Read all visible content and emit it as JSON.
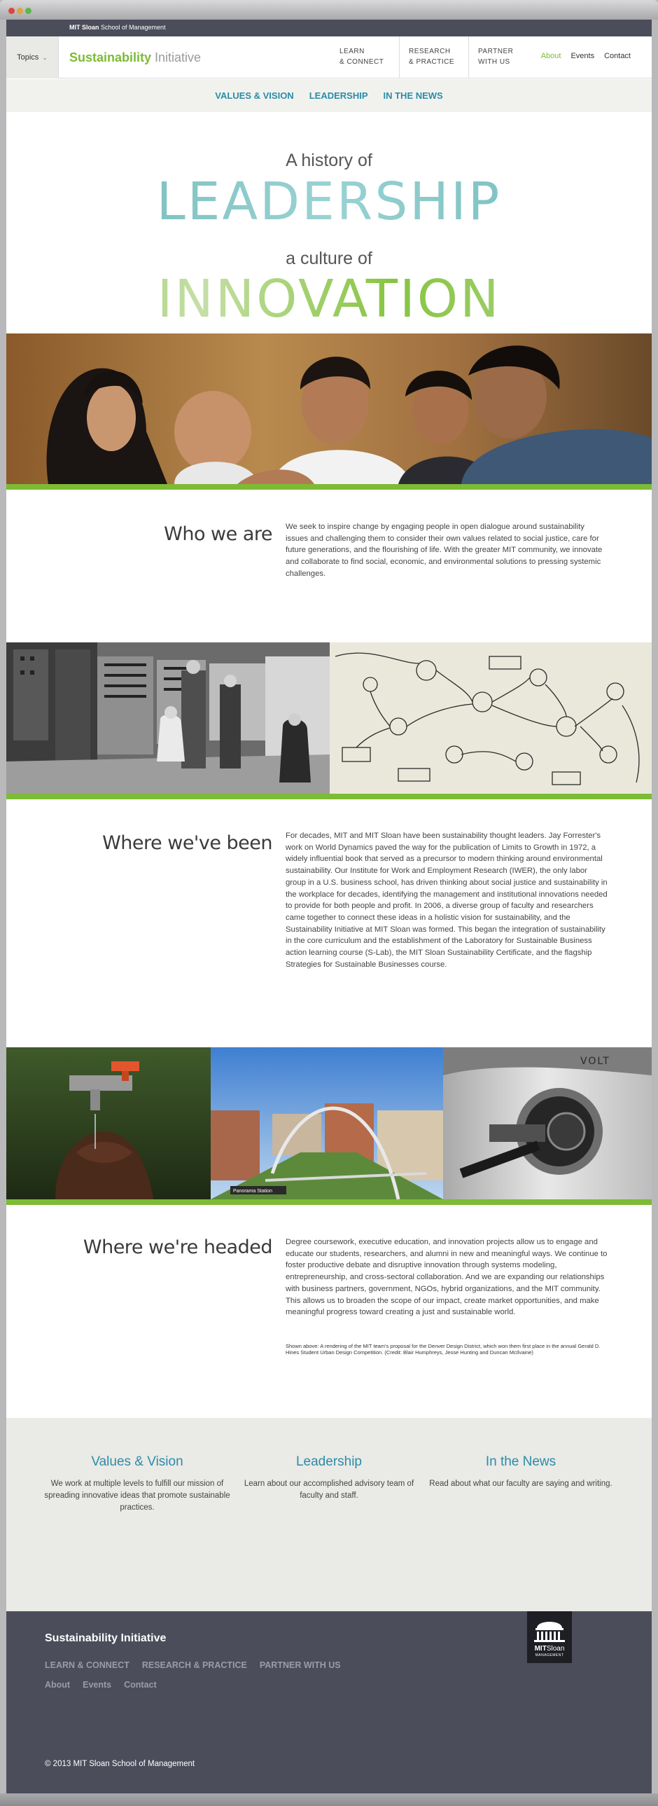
{
  "topbar": {
    "school_bold": "MIT Sloan",
    "school_rest": " School of Management"
  },
  "header": {
    "topics_label": "Topics",
    "site_title_strong": "Sustainability",
    "site_title_light": " Initiative",
    "main_nav": [
      "LEARN\n& CONNECT",
      "RESEARCH\n& PRACTICE",
      "PARTNER\nWITH US"
    ],
    "util_nav": [
      "About",
      "Events",
      "Contact"
    ]
  },
  "subnav": [
    "VALUES & VISION",
    "LEADERSHIP",
    "IN THE NEWS"
  ],
  "hero": {
    "line1": "A history of",
    "word1": "LEADERSHIP",
    "line2": "a culture of",
    "word2": "INNOVATION"
  },
  "sections": {
    "who": {
      "heading": "Who we are",
      "body": "We seek to inspire change by engaging people in open dialogue around sustainability issues and challenging them to consider their own values related to social justice, care for future generations, and the flourishing of life. With the greater MIT community, we innovate and collaborate to find social, economic, and environmental solutions to pressing systemic challenges."
    },
    "been": {
      "heading": "Where we've been",
      "body": "For decades, MIT and MIT Sloan have been sustainability thought leaders. Jay Forrester's work on World Dynamics paved the way for the publication of Limits to Growth in 1972, a widely influential book that served as a precursor to modern thinking around environmental sustainability. Our Institute for Work and Employment Research (IWER), the only labor group in a U.S. business school, has driven thinking about social justice and sustainability in the workplace for decades, identifying the management and institutional innovations needed to provide for both people and profit.  In 2006, a diverse group of faculty and researchers came together to connect these ideas in a holistic vision for sustainability, and the Sustainability Initiative at MIT Sloan was formed. This began the integration of sustainability in the core curriculum and the establishment of the Laboratory for Sustainable Business action learning course (S-Lab), the MIT Sloan Sustainability Certificate, and the flagship Strategies for Sustainable Businesses course."
    },
    "headed": {
      "heading": "Where we're headed",
      "body": "Degree coursework, executive education, and innovation projects allow us to engage and educate our students, researchers, and alumni in new and meaningful ways. We continue to foster productive debate and disruptive innovation through systems modeling, entrepreneurship, and cross-sectoral collaboration. And we are expanding our relationships with business partners, government, NGOs, hybrid organizations, and the MIT community. This allows us to broaden the scope of our impact, create market opportunities, and make meaningful progress toward creating a just and sustainable world.",
      "caption": "Shown above: A rendering of the MIT team's proposal for the Denver Design District, which won them first place in the annual Gerald D. Hines Student Urban Design Competition. (Credit: Blair Humphreys, Jesse Hunting and Duncan McIlvaine)"
    }
  },
  "photo_labels": {
    "bridge_sign": "Panorama Station",
    "car_badge": "VOLT"
  },
  "cards": [
    {
      "title": "Values & Vision",
      "text": "We work at multiple levels to fulfill our mission of spreading innovative ideas that promote sustainable practices."
    },
    {
      "title": "Leadership",
      "text": "Learn about our accomplished advisory team of faculty and staff."
    },
    {
      "title": "In the News",
      "text": "Read about what our faculty are saying and writing."
    }
  ],
  "footer": {
    "title": "Sustainability Initiative",
    "nav_primary": [
      "LEARN & CONNECT",
      "RESEARCH & PRACTICE",
      "PARTNER WITH US"
    ],
    "nav_secondary": [
      "About",
      "Events",
      "Contact"
    ],
    "copyright": "© 2013 MIT Sloan School of Management",
    "logo_mit": "MIT",
    "logo_sloan": "Sloan",
    "logo_mgmt": "MANAGEMENT"
  }
}
